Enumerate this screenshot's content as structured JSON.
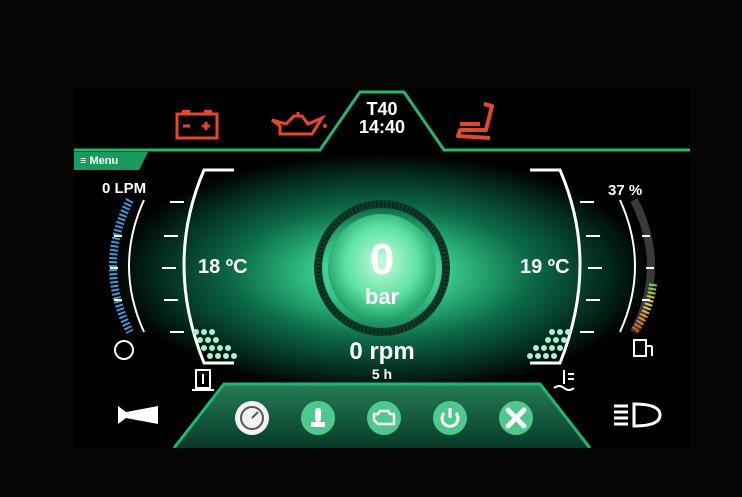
{
  "header": {
    "title": "T40",
    "time": "14:40"
  },
  "warnings": [
    {
      "name": "battery-warning-icon",
      "color": "#e8462a"
    },
    {
      "name": "oil-pressure-warning-icon",
      "color": "#e8462a"
    },
    {
      "name": "seat-warning-icon",
      "color": "#e8462a"
    }
  ],
  "menu": {
    "label": "≡ Menu"
  },
  "gauges": {
    "flow": {
      "label": "0 LPM"
    },
    "fuel": {
      "label": "37 %",
      "level": 0.37
    },
    "temp_left": {
      "label": "18 ºC"
    },
    "temp_right": {
      "label": "19 ºC"
    },
    "pressure": {
      "value": "0",
      "unit": "bar"
    },
    "rpm": "0 rpm",
    "hours": "5 h"
  },
  "bottom_buttons": [
    {
      "name": "gauges-button",
      "icon": "speedometer-icon",
      "active": true
    },
    {
      "name": "joystick-button",
      "icon": "joystick-icon",
      "active": false
    },
    {
      "name": "engine-button",
      "icon": "engine-icon",
      "active": false
    },
    {
      "name": "power-button",
      "icon": "power-icon",
      "active": false
    },
    {
      "name": "settings-button",
      "icon": "wrench-icon",
      "active": false
    }
  ],
  "colors": {
    "accent": "#1fb86a",
    "warning": "#e8462a",
    "gauge_blue": "#3d9be0",
    "glow": "#2fd38a"
  }
}
